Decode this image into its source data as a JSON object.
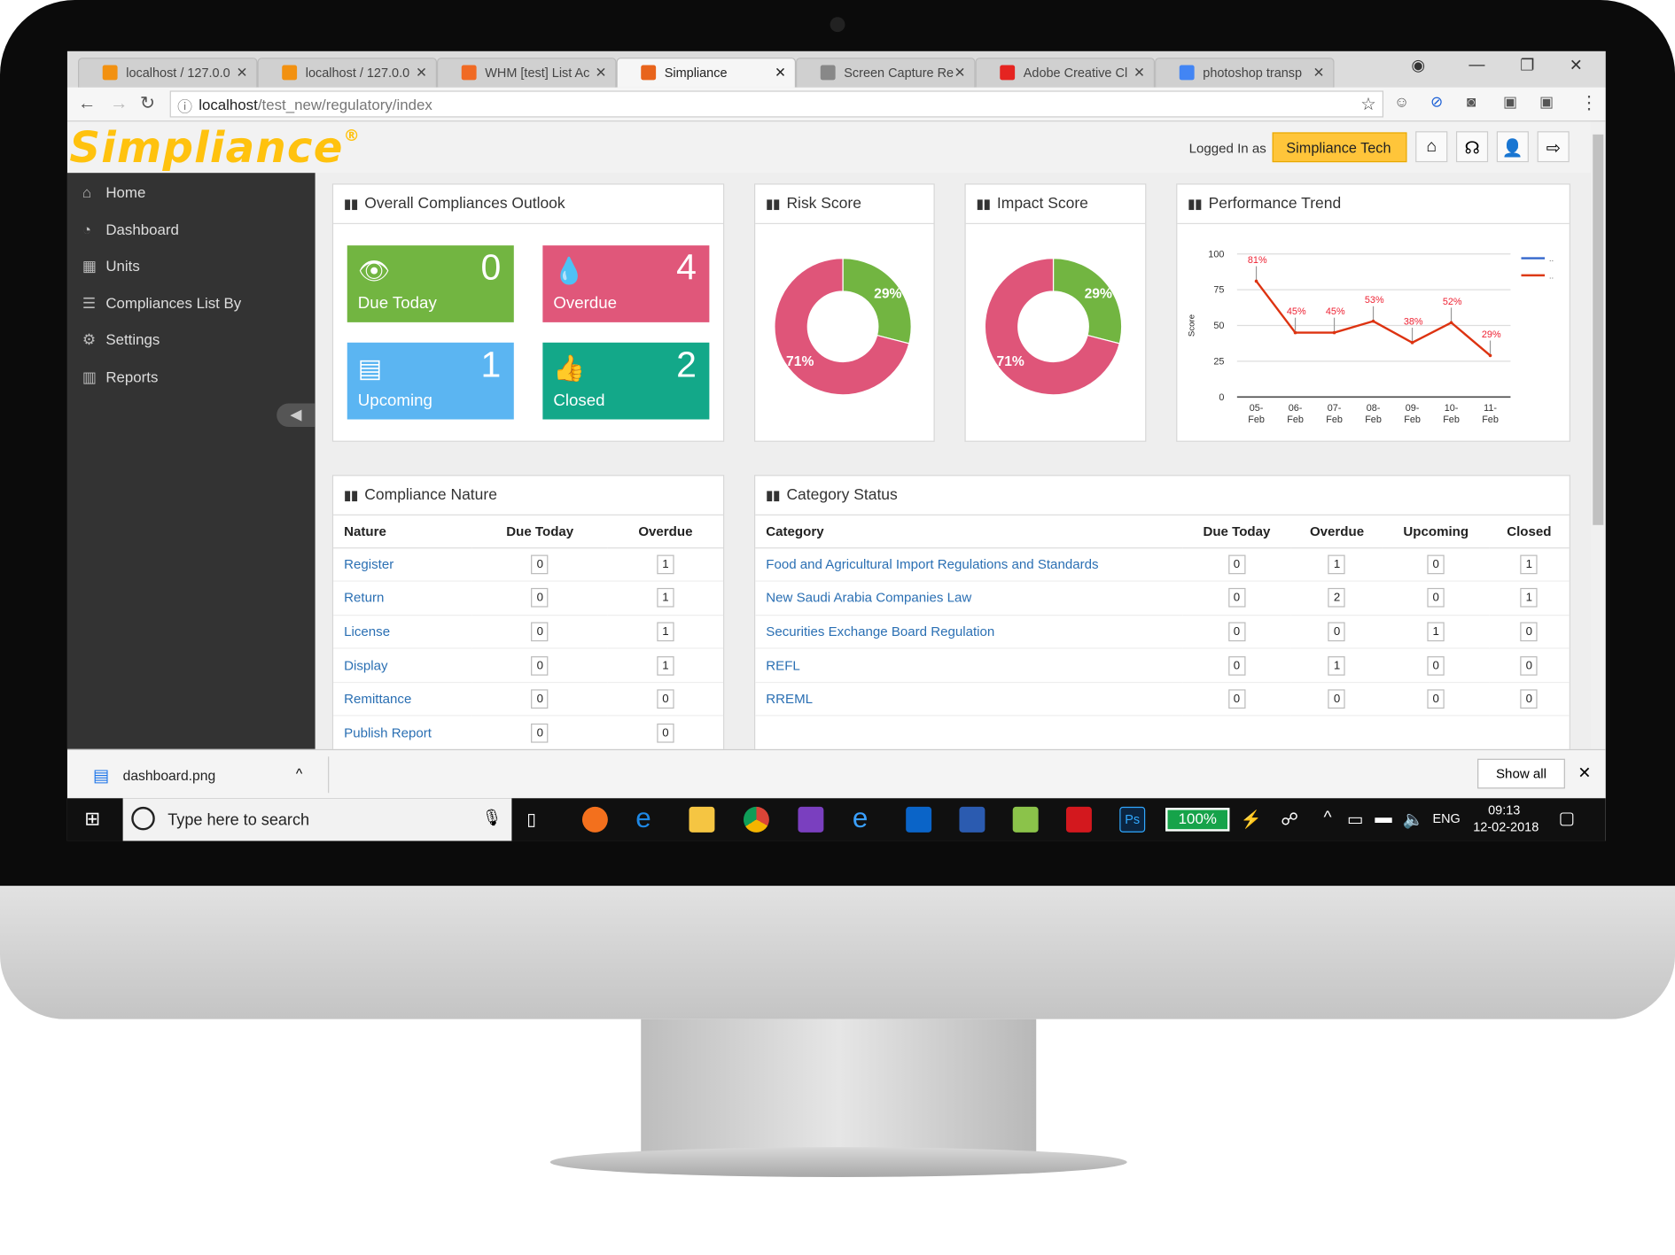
{
  "browser": {
    "tabs": [
      {
        "title": "localhost / 127.0.0"
      },
      {
        "title": "localhost / 127.0.0"
      },
      {
        "title": "WHM [test] List Ac"
      },
      {
        "title": "Simpliance",
        "active": true
      },
      {
        "title": "Screen Capture Re"
      },
      {
        "title": "Adobe Creative Cl"
      },
      {
        "title": "photoshop transp"
      }
    ],
    "url_host": "localhost",
    "url_path": "/test_new/regulatory/index"
  },
  "header": {
    "logo": "Simpliance",
    "logged_in_label": "Logged In as",
    "user": "Simpliance Tech"
  },
  "sidebar": {
    "items": [
      {
        "label": "Home",
        "icon": "home-icon"
      },
      {
        "label": "Dashboard",
        "icon": "dashboard-icon"
      },
      {
        "label": "Units",
        "icon": "units-icon"
      },
      {
        "label": "Compliances List By",
        "icon": "list-icon"
      },
      {
        "label": "Settings",
        "icon": "gear-icon"
      },
      {
        "label": "Reports",
        "icon": "chart-icon"
      }
    ]
  },
  "outlook": {
    "title": "Overall Compliances Outlook",
    "tiles": [
      {
        "label": "Due Today",
        "value": "0",
        "color": "#72b541"
      },
      {
        "label": "Overdue",
        "value": "4",
        "color": "#e0577a"
      },
      {
        "label": "Upcoming",
        "value": "1",
        "color": "#5bb5f2"
      },
      {
        "label": "Closed",
        "value": "2",
        "color": "#13a889"
      }
    ]
  },
  "risk": {
    "title": "Risk Score"
  },
  "impact": {
    "title": "Impact Score"
  },
  "performance": {
    "title": "Performance Trend"
  },
  "chart_data": [
    {
      "type": "pie",
      "title": "Risk Score",
      "values": [
        29,
        71
      ],
      "labels": [
        "29%",
        "71%"
      ],
      "colors": [
        "#72b541",
        "#df5579"
      ],
      "donut": true
    },
    {
      "type": "pie",
      "title": "Impact Score",
      "values": [
        29,
        71
      ],
      "labels": [
        "29%",
        "71%"
      ],
      "colors": [
        "#72b541",
        "#df5579"
      ],
      "donut": true
    },
    {
      "type": "line",
      "title": "Performance Trend",
      "ylabel": "Score",
      "ylim": [
        0,
        100
      ],
      "yticks": [
        0,
        25,
        50,
        75,
        100
      ],
      "categories": [
        "05-Feb",
        "06-Feb",
        "07-Feb",
        "08-Feb",
        "09-Feb",
        "10-Feb",
        "11-Feb"
      ],
      "series": [
        {
          "values": [
            81,
            45,
            45,
            53,
            38,
            52,
            29
          ],
          "labels": [
            "81%",
            "45%",
            "45%",
            "53%",
            "38%",
            "52%",
            "29%"
          ],
          "color": "#dd3311"
        }
      ],
      "legend": {
        "placement": "right",
        "entries": [
          {
            "text": "..",
            "color": "#3366cc"
          },
          {
            "text": "..",
            "color": "#dc3912"
          }
        ]
      },
      "grid": true
    }
  ],
  "nature": {
    "title": "Compliance Nature",
    "columns": [
      "Nature",
      "Due Today",
      "Overdue"
    ],
    "rows": [
      [
        "Register",
        "0",
        "1"
      ],
      [
        "Return",
        "0",
        "1"
      ],
      [
        "License",
        "0",
        "1"
      ],
      [
        "Display",
        "0",
        "1"
      ],
      [
        "Remittance",
        "0",
        "0"
      ],
      [
        "Publish Report",
        "0",
        "0"
      ]
    ]
  },
  "category": {
    "title": "Category Status",
    "columns": [
      "Category",
      "Due Today",
      "Overdue",
      "Upcoming",
      "Closed"
    ],
    "rows": [
      [
        "Food and Agricultural Import Regulations and Standards",
        "0",
        "1",
        "0",
        "1"
      ],
      [
        "New Saudi Arabia Companies Law",
        "0",
        "2",
        "0",
        "1"
      ],
      [
        "Securities Exchange Board Regulation",
        "0",
        "0",
        "1",
        "0"
      ],
      [
        "REFL",
        "0",
        "1",
        "0",
        "0"
      ],
      [
        "RREML",
        "0",
        "0",
        "0",
        "0"
      ]
    ]
  },
  "download": {
    "file": "dashboard.png",
    "show_all": "Show all"
  },
  "taskbar": {
    "search_placeholder": "Type here to search",
    "battery": "100%",
    "lang": "ENG",
    "time": "09:13",
    "date": "12-02-2018"
  }
}
